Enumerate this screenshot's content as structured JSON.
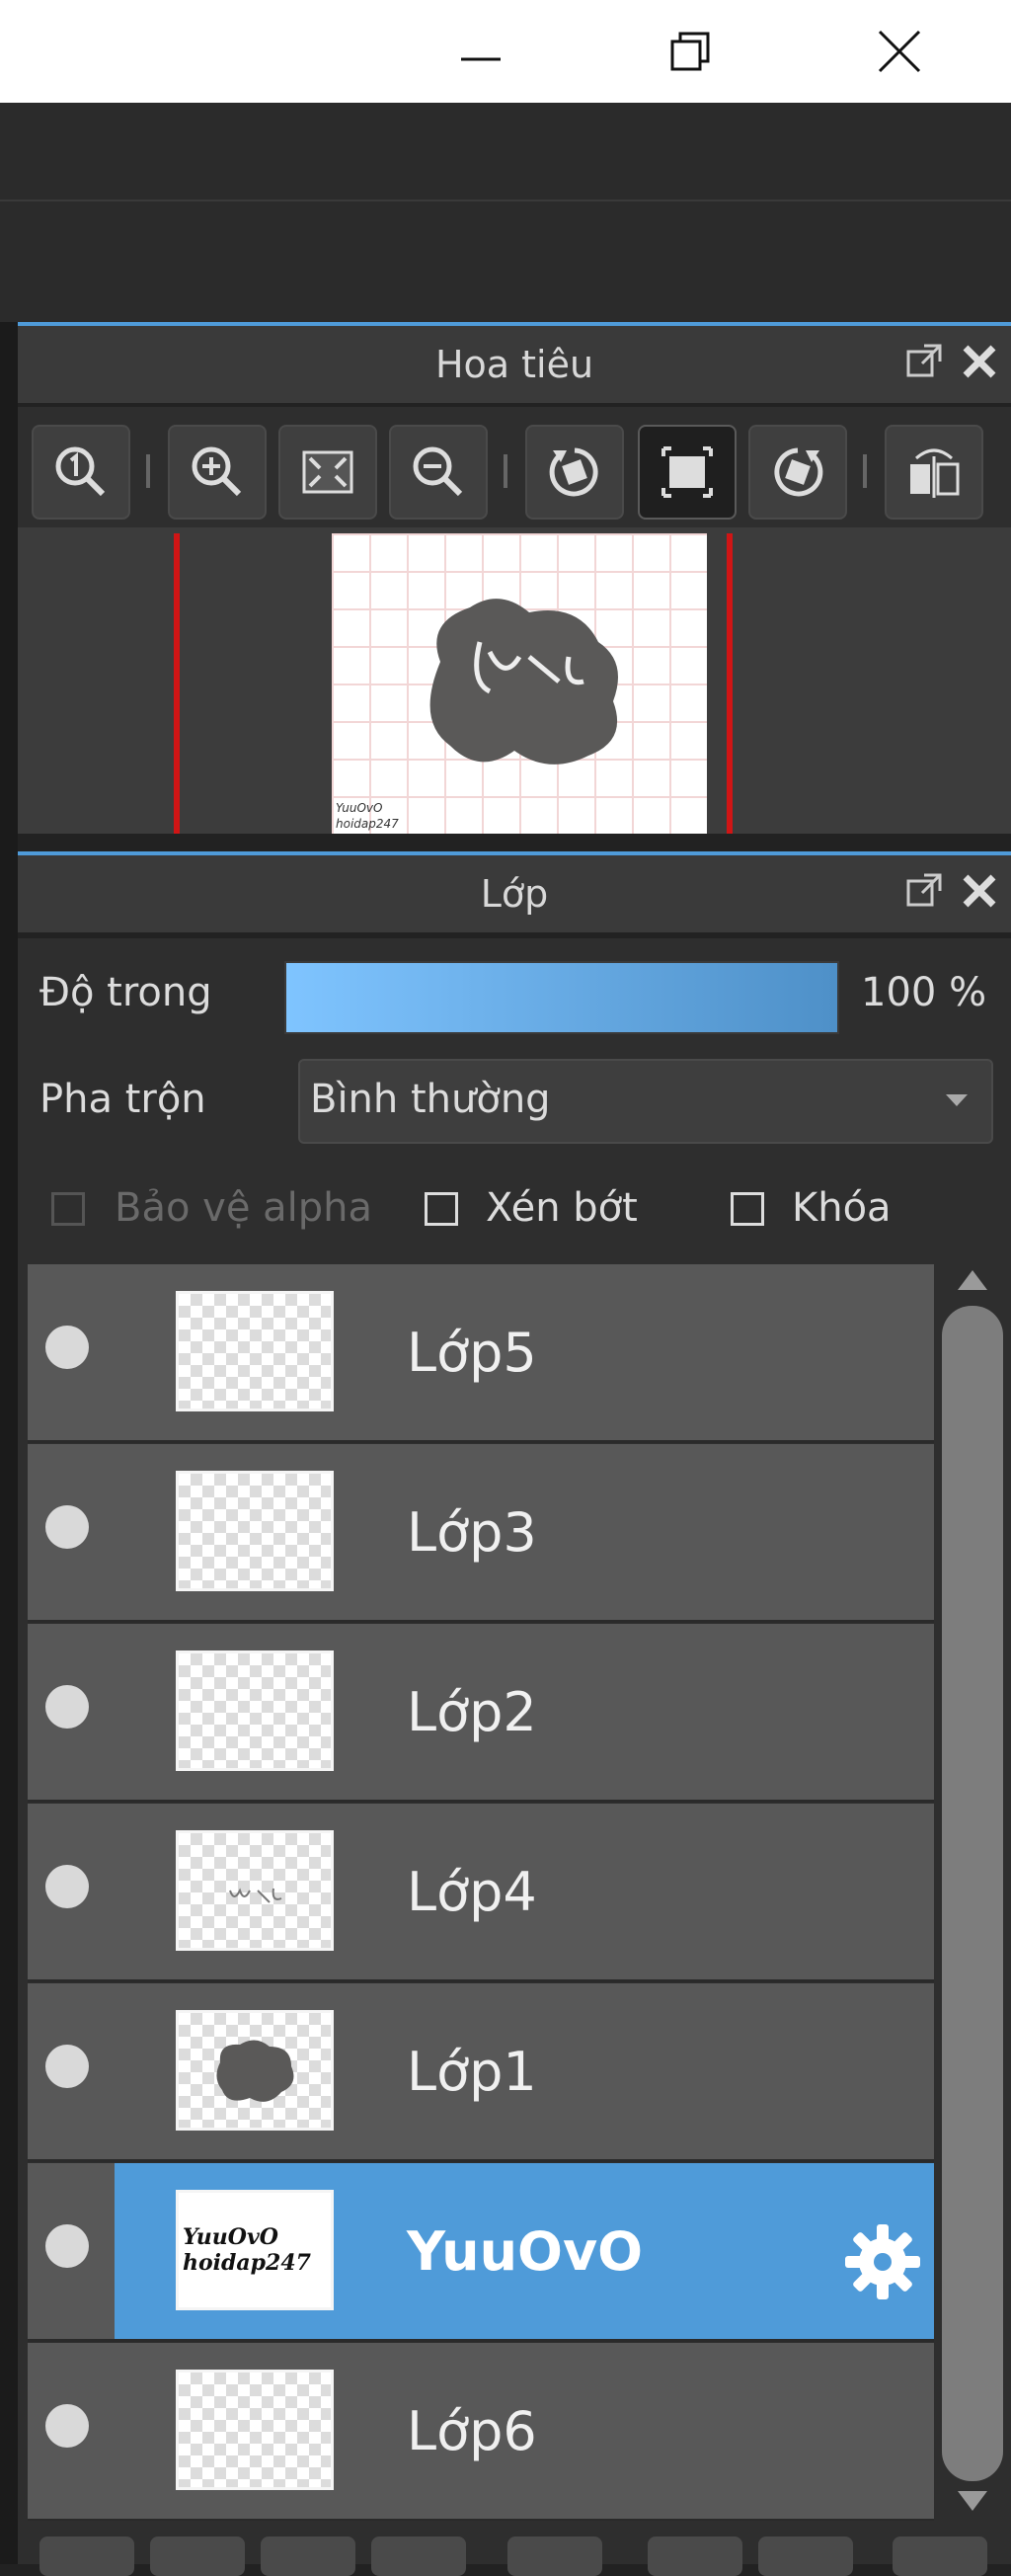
{
  "window": {
    "buttons": [
      {
        "name": "minimize-icon"
      },
      {
        "name": "maximize-icon"
      },
      {
        "name": "close-icon"
      }
    ]
  },
  "navigator": {
    "title": "Hoa tiêu",
    "tools": [
      "zoom-actual-icon",
      "zoom-in-icon",
      "fit-screen-icon",
      "zoom-out-icon",
      "rotate-left-icon",
      "fit-window-icon",
      "rotate-right-icon",
      "flip-horizontal-icon"
    ]
  },
  "layers": {
    "title": "Lớp",
    "opacity_label": "Độ trong",
    "opacity_value": "100 %",
    "opacity_fraction": 1.0,
    "blend_label": "Pha trộn",
    "blend_value": "Bình thường",
    "protect_alpha_label": "Bảo vệ alpha",
    "clipping_label": "Xén bớt",
    "lock_label": "Khóa",
    "items": [
      {
        "name": "Lớp5"
      },
      {
        "name": "Lớp3"
      },
      {
        "name": "Lớp2"
      },
      {
        "name": "Lớp4"
      },
      {
        "name": "Lớp1"
      },
      {
        "name": "YuuOvO",
        "selected": true,
        "thumb_text_1": "YuuOvO",
        "thumb_text_2": "hoidap247"
      },
      {
        "name": "Lớp6"
      }
    ]
  },
  "colors": {
    "accent": "#4f9bd9",
    "slider_start": "#7fc4ff",
    "slider_end": "#4e90c8",
    "frame_red": "#d01515"
  }
}
